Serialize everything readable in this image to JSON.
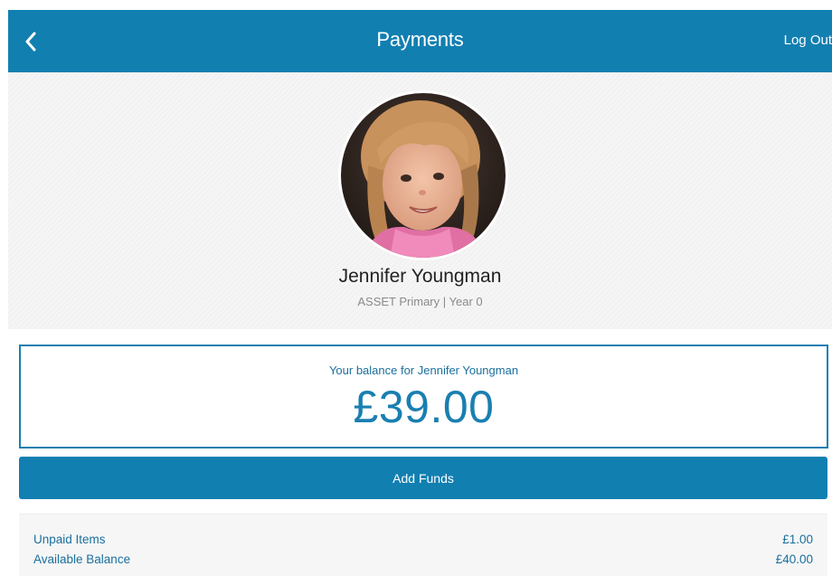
{
  "header": {
    "title": "Payments",
    "logout_label": "Log Out",
    "bar_color": "#127fb1"
  },
  "icons": {
    "back": "chevron-left-icon"
  },
  "profile": {
    "name": "Jennifer Youngman",
    "subtitle": "ASSET Primary | Year 0"
  },
  "balance": {
    "label": "Your balance for Jennifer Youngman",
    "amount": "£39.00"
  },
  "actions": {
    "add_funds_label": "Add Funds"
  },
  "summary": {
    "rows": [
      {
        "label": "Unpaid Items",
        "value": "£1.00"
      },
      {
        "label": "Available Balance",
        "value": "£40.00"
      }
    ]
  }
}
